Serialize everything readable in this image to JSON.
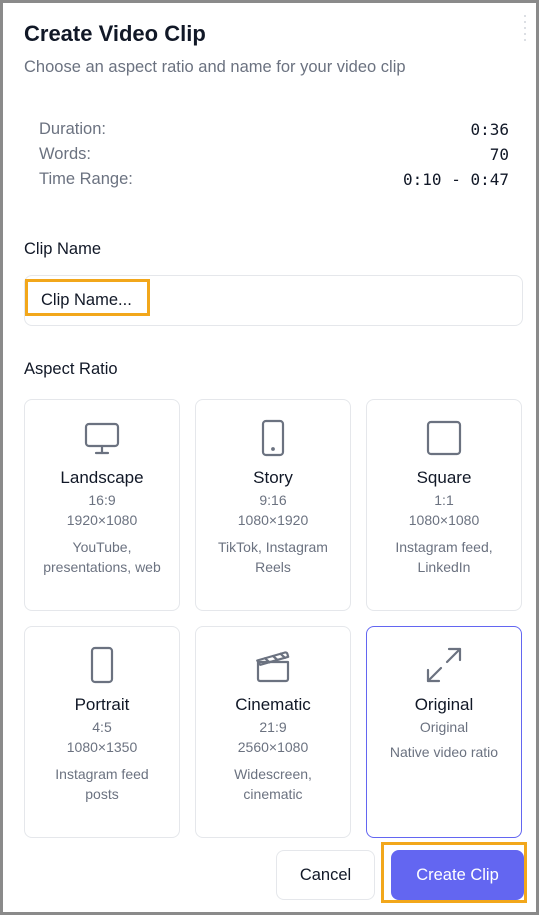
{
  "dialog": {
    "title": "Create Video Clip",
    "subtitle": "Choose an aspect ratio and name for your video clip"
  },
  "stats": [
    {
      "label": "Duration:",
      "value": "0:36"
    },
    {
      "label": "Words:",
      "value": "70"
    },
    {
      "label": "Time Range:",
      "value": "0:10 - 0:47"
    }
  ],
  "clip_name": {
    "label": "Clip Name",
    "placeholder": "Clip Name...",
    "value": ""
  },
  "aspect_ratio": {
    "label": "Aspect Ratio",
    "options": [
      {
        "name": "Landscape",
        "ratio": "16:9",
        "resolution": "1920×1080",
        "description": "YouTube, presentations, web",
        "icon": "monitor-icon",
        "selected": false
      },
      {
        "name": "Story",
        "ratio": "9:16",
        "resolution": "1080×1920",
        "description": "TikTok, Instagram Reels",
        "icon": "smartphone-icon",
        "selected": false
      },
      {
        "name": "Square",
        "ratio": "1:1",
        "resolution": "1080×1080",
        "description": "Instagram feed, LinkedIn",
        "icon": "square-icon",
        "selected": false
      },
      {
        "name": "Portrait",
        "ratio": "4:5",
        "resolution": "1080×1350",
        "description": "Instagram feed posts",
        "icon": "portrait-rect-icon",
        "selected": false
      },
      {
        "name": "Cinematic",
        "ratio": "21:9",
        "resolution": "2560×1080",
        "description": "Widescreen, cinematic",
        "icon": "clapperboard-icon",
        "selected": false
      },
      {
        "name": "Original",
        "ratio": "Original",
        "resolution": "",
        "description": "Native video ratio",
        "icon": "expand-arrows-icon",
        "selected": true
      }
    ]
  },
  "buttons": {
    "cancel": "Cancel",
    "create": "Create Clip"
  },
  "colors": {
    "accent": "#6366f1",
    "highlight": "#f2a71b",
    "muted_text": "#6b7280",
    "icon_stroke": "#6b7280"
  }
}
